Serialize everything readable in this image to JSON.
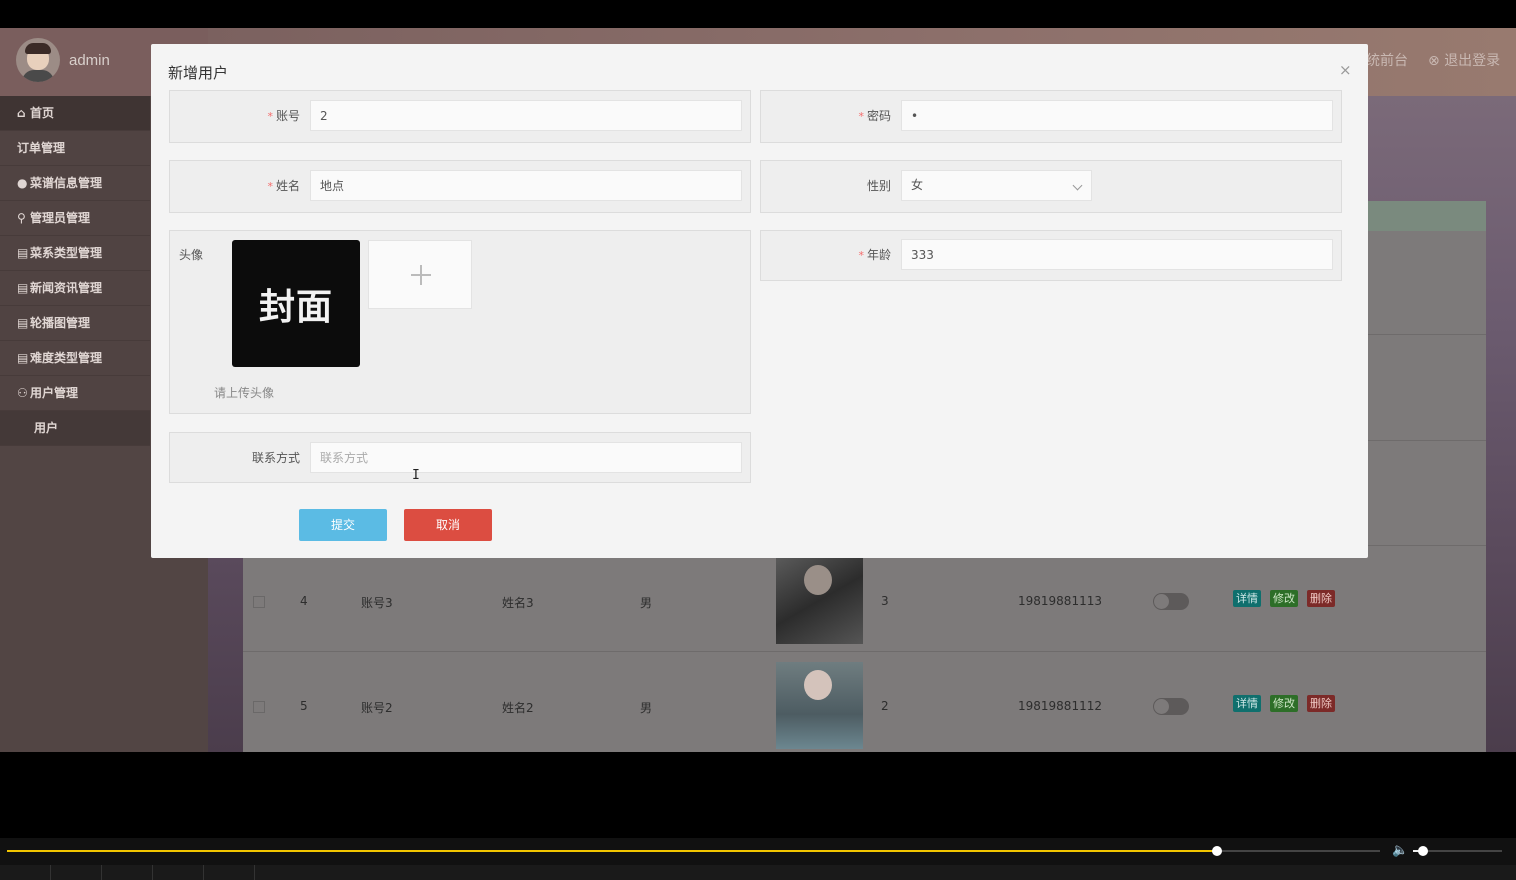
{
  "app": {
    "user": "admin",
    "top_links": [
      "统前台",
      "退出登录"
    ]
  },
  "sidebar": {
    "items": [
      {
        "icon": "⌂",
        "label": "首页"
      },
      {
        "icon": "",
        "label": "订单管理"
      },
      {
        "icon": "●",
        "label": "菜谱信息管理"
      },
      {
        "icon": "⚲",
        "label": "管理员管理"
      },
      {
        "icon": "▤",
        "label": "菜系类型管理"
      },
      {
        "icon": "▤",
        "label": "新闻资讯管理"
      },
      {
        "icon": "▤",
        "label": "轮播图管理"
      },
      {
        "icon": "▤",
        "label": "难度类型管理"
      },
      {
        "icon": "⚇",
        "label": "用户管理"
      },
      {
        "icon": "",
        "label": "用户"
      }
    ]
  },
  "table": {
    "rows": [
      {
        "id": "4",
        "account": "账号3",
        "name": "姓名3",
        "gender": "男",
        "age": "3",
        "phone": "19819881113",
        "actions": [
          "详情",
          "修改",
          "删除"
        ]
      },
      {
        "id": "5",
        "account": "账号2",
        "name": "姓名2",
        "gender": "男",
        "age": "2",
        "phone": "19819881112",
        "actions": [
          "详情",
          "修改",
          "删除"
        ]
      }
    ]
  },
  "modal": {
    "title": "新增用户",
    "close_icon": "×",
    "fields": {
      "account": {
        "label": "账号",
        "value": "2",
        "required": true
      },
      "password": {
        "label": "密码",
        "value": "•",
        "required": true
      },
      "name": {
        "label": "姓名",
        "value": "地点",
        "required": true
      },
      "gender": {
        "label": "性别",
        "value": "女"
      },
      "avatar": {
        "label": "头像",
        "cover_text": "封面",
        "tip": "请上传头像"
      },
      "age": {
        "label": "年龄",
        "value": "333",
        "required": true
      },
      "contact": {
        "label": "联系方式",
        "value": "",
        "placeholder": "联系方式"
      }
    },
    "buttons": {
      "submit": "提交",
      "cancel": "取消"
    }
  },
  "player": {
    "progress_percent": 88.2,
    "volume_percent": 10
  }
}
